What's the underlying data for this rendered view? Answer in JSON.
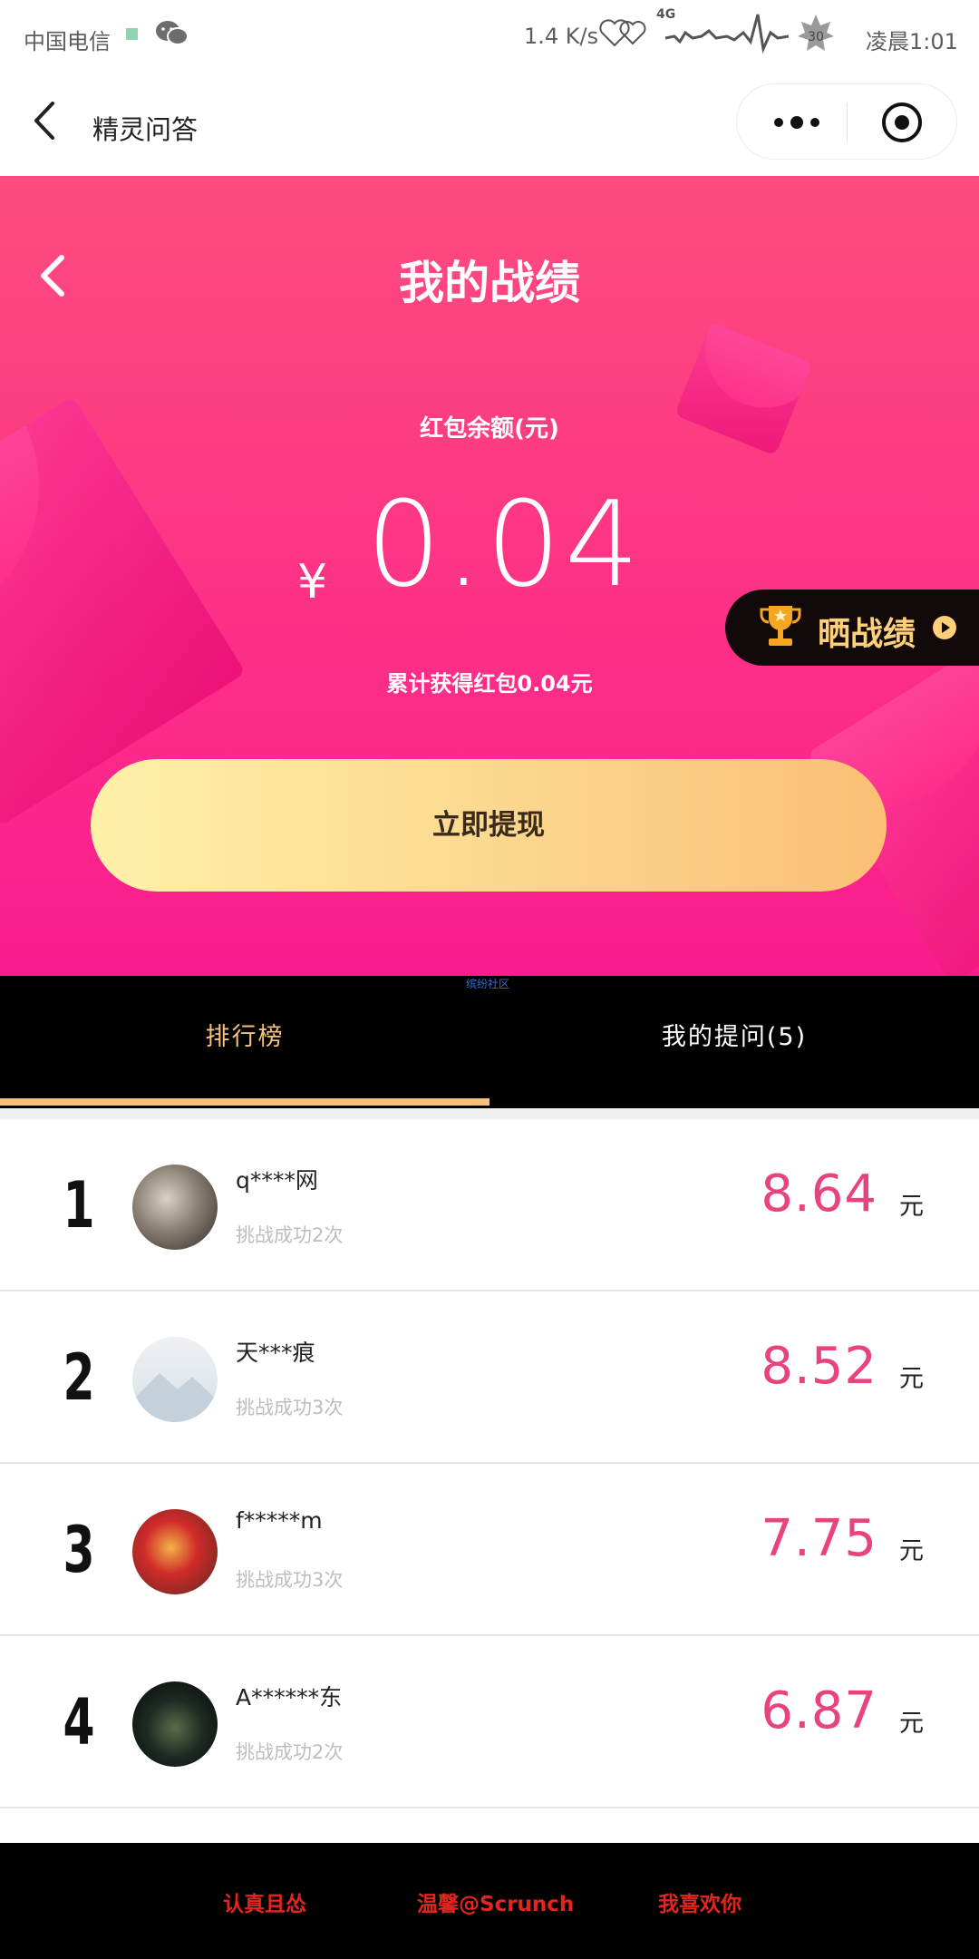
{
  "status_bar": {
    "carrier": "中国电信",
    "speed": "1.4 K/s",
    "network": "4G",
    "temperature": "30",
    "time": "凌晨1:01"
  },
  "nav": {
    "title": "精灵问答"
  },
  "hero": {
    "title": "我的战绩",
    "balance_label": "红包余额(元)",
    "currency": "¥",
    "amount": "0.04",
    "total_text": "累计获得红包0.04元",
    "withdraw_label": "立即提现",
    "share_label": "晒战绩"
  },
  "tabs": {
    "watermark": "缤纷社区",
    "items": [
      {
        "label": "排行榜",
        "active": true
      },
      {
        "label": "我的提问(5)",
        "active": false
      }
    ]
  },
  "leaderboard": [
    {
      "rank": "1",
      "name": "q****网",
      "sub": "挑战成功2次",
      "amount": "8.64",
      "unit": "元"
    },
    {
      "rank": "2",
      "name": "天***痕",
      "sub": "挑战成功3次",
      "amount": "8.52",
      "unit": "元"
    },
    {
      "rank": "3",
      "name": "f*****m",
      "sub": "挑战成功3次",
      "amount": "7.75",
      "unit": "元"
    },
    {
      "rank": "4",
      "name": "A******东",
      "sub": "挑战成功2次",
      "amount": "6.87",
      "unit": "元"
    }
  ],
  "footer": {
    "items": [
      "认真且怂",
      "温馨@Scrunch",
      "我喜欢你"
    ]
  },
  "colors": {
    "hero_top": "#fe4c7e",
    "hero_bottom": "#fb1b8f",
    "button_gold": "#fcd68d",
    "amount_pink": "#e8427f",
    "tab_active": "#f7c278"
  }
}
